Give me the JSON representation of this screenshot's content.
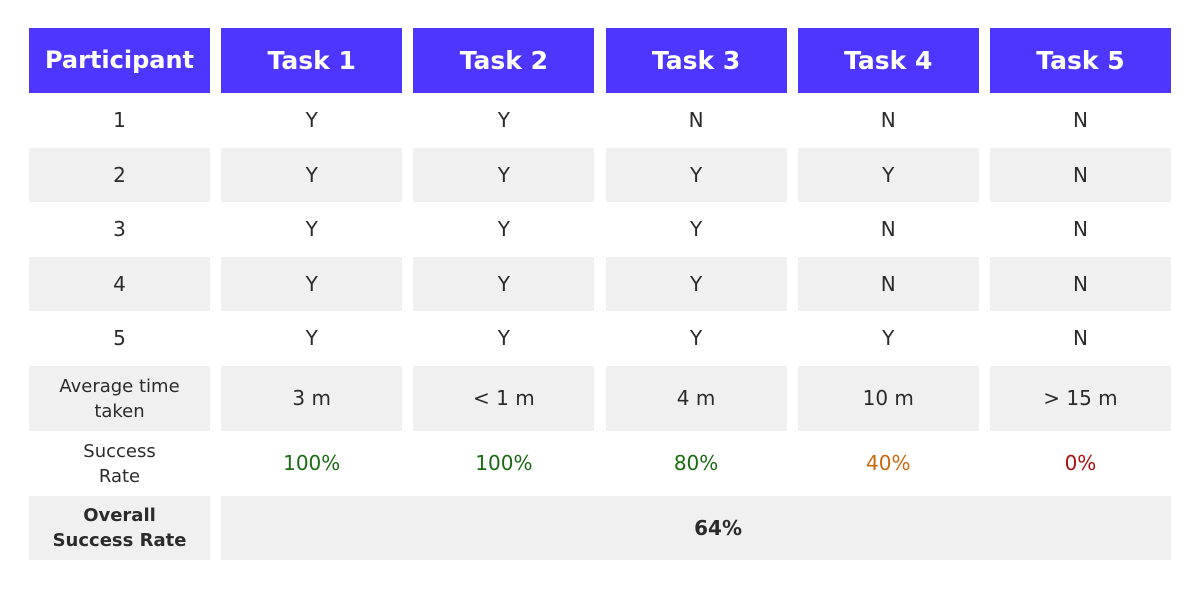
{
  "table": {
    "headers": [
      "Participant",
      "Task 1",
      "Task 2",
      "Task 3",
      "Task 4",
      "Task 5"
    ],
    "rows": [
      {
        "participant": "1",
        "tasks": [
          "Y",
          "Y",
          "N",
          "N",
          "N"
        ]
      },
      {
        "participant": "2",
        "tasks": [
          "Y",
          "Y",
          "Y",
          "Y",
          "N"
        ]
      },
      {
        "participant": "3",
        "tasks": [
          "Y",
          "Y",
          "Y",
          "N",
          "N"
        ]
      },
      {
        "participant": "4",
        "tasks": [
          "Y",
          "Y",
          "Y",
          "N",
          "N"
        ]
      },
      {
        "participant": "5",
        "tasks": [
          "Y",
          "Y",
          "Y",
          "Y",
          "N"
        ]
      }
    ],
    "average_time": {
      "label_line1": "Average time",
      "label_line2": "taken",
      "values": [
        "3 m",
        "< 1 m",
        "4 m",
        "10 m",
        "> 15 m"
      ]
    },
    "success_rate": {
      "label_line1": "Success",
      "label_line2": "Rate",
      "values": [
        "100%",
        "100%",
        "80%",
        "40%",
        "0%"
      ],
      "colors": [
        "#1a6b12",
        "#1a6b12",
        "#1a6b12",
        "#c8690e",
        "#b00f0f"
      ]
    },
    "overall": {
      "label_line1": "Overall",
      "label_line2": "Success Rate",
      "value": "64%"
    }
  },
  "colors": {
    "header_bg": "#4f36ff",
    "stripe_bg": "#f0f0f0"
  }
}
